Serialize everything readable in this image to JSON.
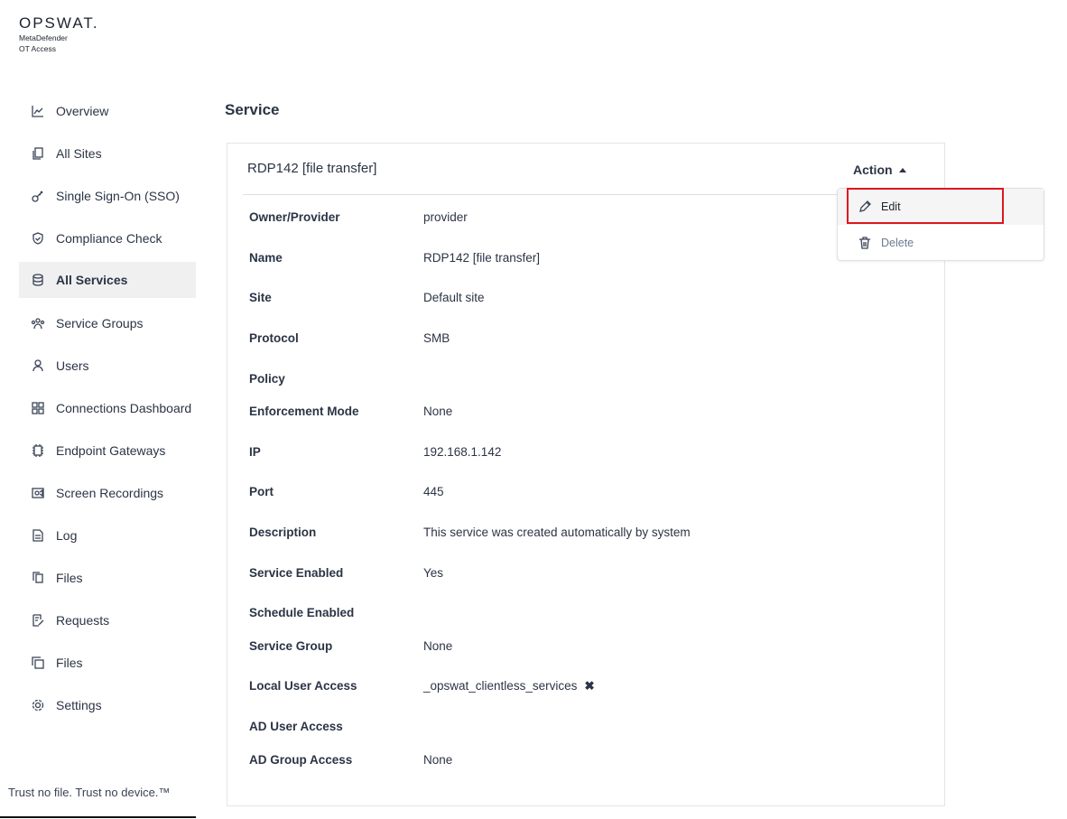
{
  "logo": {
    "brand": "OPSWAT.",
    "line1": "MetaDefender",
    "line2": "OT Access"
  },
  "sidebar": {
    "items": [
      {
        "label": "Overview",
        "icon": "chart-line-icon"
      },
      {
        "label": "All Sites",
        "icon": "copy-icon"
      },
      {
        "label": "Single Sign-On (SSO)",
        "icon": "key-icon"
      },
      {
        "label": "Compliance Check",
        "icon": "shield-check-icon"
      },
      {
        "label": "All Services",
        "icon": "database-icon",
        "active": true
      },
      {
        "label": "Service Groups",
        "icon": "group-icon"
      },
      {
        "label": "Users",
        "icon": "user-icon"
      },
      {
        "label": "Connections Dashboard",
        "icon": "grid-icon"
      },
      {
        "label": "Endpoint Gateways",
        "icon": "chip-icon"
      },
      {
        "label": "Screen Recordings",
        "icon": "video-icon"
      },
      {
        "label": "Log",
        "icon": "document-icon"
      },
      {
        "label": "Files",
        "icon": "files-icon"
      },
      {
        "label": "Requests",
        "icon": "edit-note-icon"
      },
      {
        "label": "Files",
        "icon": "square-stack-icon"
      },
      {
        "label": "Settings",
        "icon": "gear-icon"
      }
    ],
    "tagline": "Trust no file. Trust no device.™"
  },
  "page": {
    "title": "Service"
  },
  "card": {
    "title": "RDP142 [file transfer]",
    "action_label": "Action",
    "fields": [
      {
        "k": "Owner/Provider",
        "v": "provider"
      },
      {
        "k": "Name",
        "v": "RDP142 [file transfer]"
      },
      {
        "k": "Site",
        "v": "Default site"
      },
      {
        "k": "Protocol",
        "v": "SMB"
      },
      {
        "k": "Policy",
        "v": ""
      },
      {
        "k": "Enforcement Mode",
        "v": "None"
      },
      {
        "k": "IP",
        "v": "192.168.1.142"
      },
      {
        "k": "Port",
        "v": "445"
      },
      {
        "k": "Description",
        "v": "This service was created automatically by system"
      },
      {
        "k": "Service Enabled",
        "v": "Yes"
      },
      {
        "k": "Schedule Enabled",
        "v": ""
      },
      {
        "k": "Service Group",
        "v": "None"
      },
      {
        "k": "Local User Access",
        "v": "_opswat_clientless_services",
        "removable": true
      },
      {
        "k": "AD User Access",
        "v": ""
      },
      {
        "k": "AD Group Access",
        "v": "None"
      }
    ]
  },
  "menu": {
    "edit": "Edit",
    "delete": "Delete"
  },
  "colors": {
    "highlight": "#e0161e",
    "active_bg": "#f0f0f0"
  }
}
